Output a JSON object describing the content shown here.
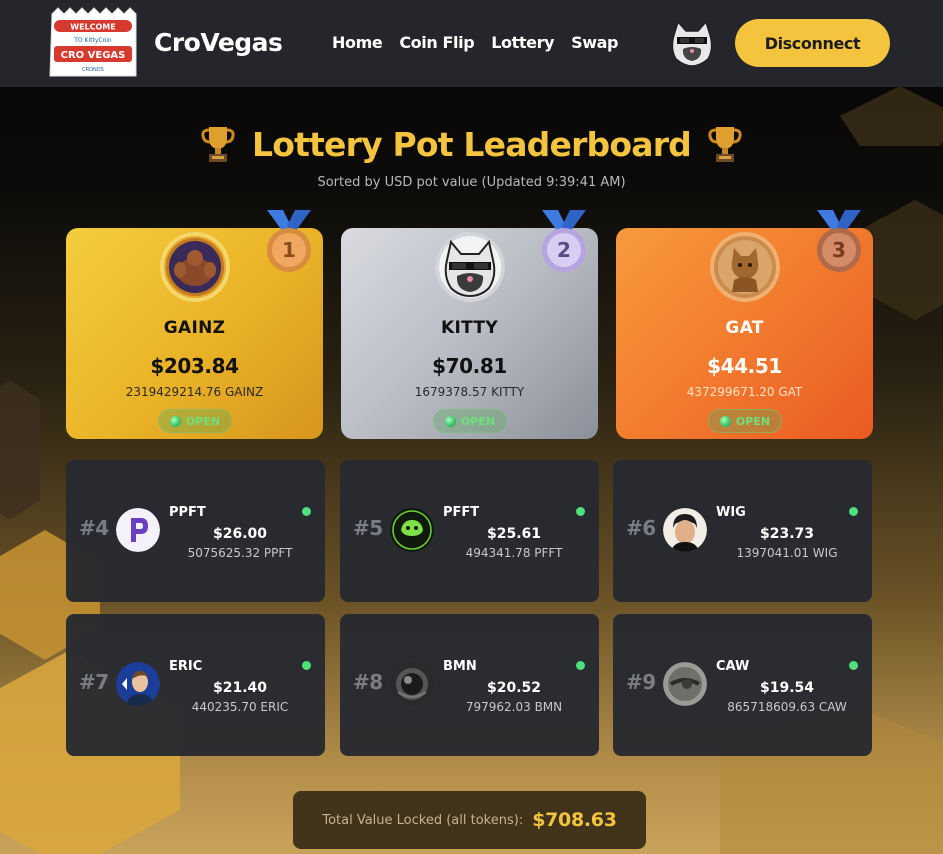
{
  "header": {
    "logo_text": "WELCOME TO CRO VEGAS",
    "brand": "CroVegas",
    "nav": [
      "Home",
      "Coin Flip",
      "Lottery",
      "Swap"
    ],
    "disconnect_label": "Disconnect"
  },
  "page": {
    "title": "Lottery Pot Leaderboard",
    "subtitle": "Sorted by USD pot value (Updated 9:39:41 AM)"
  },
  "top": [
    {
      "rank": "1",
      "name": "GAINZ",
      "usd": "$203.84",
      "amount": "2319429214.76 GAINZ",
      "status": "OPEN"
    },
    {
      "rank": "2",
      "name": "KITTY",
      "usd": "$70.81",
      "amount": "1679378.57 KITTY",
      "status": "OPEN"
    },
    {
      "rank": "3",
      "name": "GAT",
      "usd": "$44.51",
      "amount": "437299671.20 GAT",
      "status": "OPEN"
    }
  ],
  "rest": [
    {
      "rank": "#4",
      "name": "PPFT",
      "usd": "$26.00",
      "amount": "5075625.32 PPFT"
    },
    {
      "rank": "#5",
      "name": "PFFT",
      "usd": "$25.61",
      "amount": "494341.78 PFFT"
    },
    {
      "rank": "#6",
      "name": "WIG",
      "usd": "$23.73",
      "amount": "1397041.01 WIG"
    },
    {
      "rank": "#7",
      "name": "ERIC",
      "usd": "$21.40",
      "amount": "440235.70 ERIC"
    },
    {
      "rank": "#8",
      "name": "BMN",
      "usd": "$20.52",
      "amount": "797962.03 BMN"
    },
    {
      "rank": "#9",
      "name": "CAW",
      "usd": "$19.54",
      "amount": "865718609.63 CAW"
    }
  ],
  "tvl": {
    "label": "Total Value Locked (all tokens):",
    "value": "$708.63"
  },
  "colors": {
    "accent": "#f4c43e",
    "header_bg": "#25262b",
    "card_bg": "#282a30",
    "status_green": "#4ee07e"
  }
}
